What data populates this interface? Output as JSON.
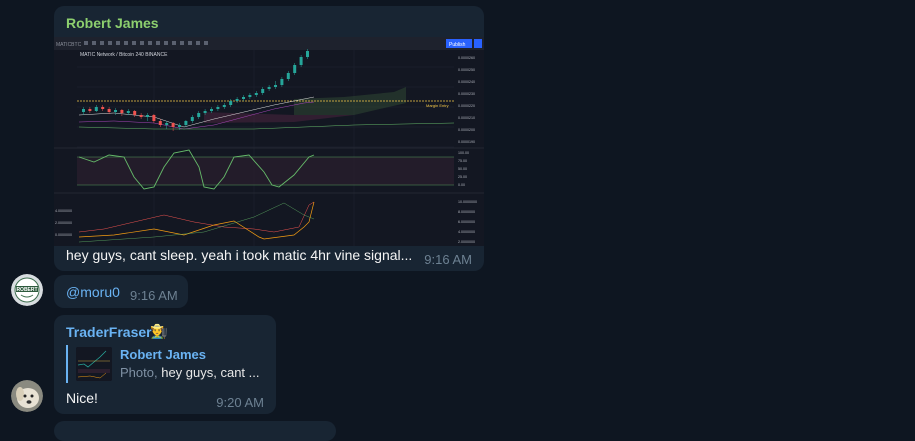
{
  "messages": [
    {
      "sender": "Robert James",
      "sender_color": "#8ccf6e",
      "text": "hey guys, cant sleep. yeah i took matic 4hr vine signal...",
      "time": "9:16 AM",
      "has_photo": true
    },
    {
      "avatar": "ROBERT",
      "mention": "@moru0",
      "time": "9:16 AM"
    },
    {
      "sender": "TraderFraser",
      "sender_color": "#6ab3f3",
      "sender_emoji": "👨‍🌾",
      "reply": {
        "name": "Robert James",
        "prefix": "Photo,",
        "snippet": "hey guys, cant ..."
      },
      "text": "Nice!",
      "time": "9:20 AM"
    }
  ],
  "chart": {
    "symbol_title": "MATIC Network / Bitcoin  240  BINANCE",
    "button_label": "Publish",
    "target_label": "Margin Entry",
    "price_labels": [
      "0.0000260",
      "0.0000250",
      "0.0000240",
      "0.0000230",
      "0.0000220",
      "0.0000210",
      "0.0000200",
      "0.0000190"
    ],
    "rsi_labels": [
      "100.00",
      "75.00",
      "50.00",
      "25.00",
      "0.00"
    ],
    "lower_labels": [
      "10.0000000",
      "8.0000000",
      "6.0000000",
      "4.0000000",
      "2.0000000"
    ],
    "lower_left_labels": [
      "4.0000000",
      "2.0000000",
      "0.0000000"
    ],
    "colors": {
      "up": "#26a69a",
      "down": "#ef5350",
      "target": "#f7c948"
    }
  }
}
